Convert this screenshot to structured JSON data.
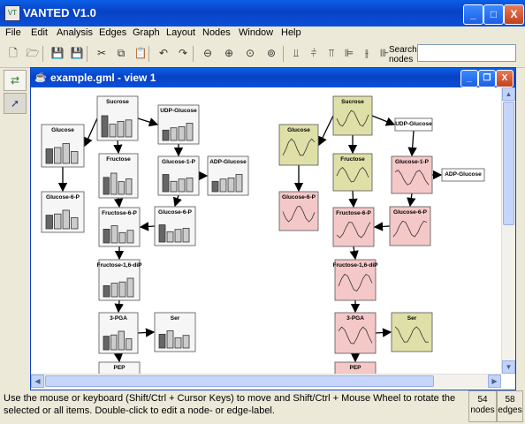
{
  "app": {
    "title": "VANTED V1.0",
    "icon_text": "VT"
  },
  "window_buttons": {
    "minimize": "_",
    "maximize": "□",
    "close": "X"
  },
  "menu": [
    {
      "label": "File",
      "underline_first": true
    },
    {
      "label": "Edit",
      "underline_first": true
    },
    {
      "label": "Analysis"
    },
    {
      "label": "Edges"
    },
    {
      "label": "Graph"
    },
    {
      "label": "Layout"
    },
    {
      "label": "Nodes"
    },
    {
      "label": "Window",
      "underline_first": true
    },
    {
      "label": "Help",
      "underline_first": true
    }
  ],
  "toolbar": {
    "icons": [
      "new-file-icon",
      "open-folder-icon",
      "save-icon",
      "save-as-icon",
      "cut-icon",
      "copy-icon",
      "paste-icon",
      "undo-icon",
      "redo-icon",
      "zoom-out-icon",
      "zoom-in-icon",
      "zoom-fit-icon",
      "zoom-reset-icon",
      "align-bottom-icon",
      "align-middle-icon",
      "align-top-icon",
      "align-left-icon",
      "align-center-icon",
      "align-right-icon",
      "distribute-h-icon",
      "distribute-v-icon"
    ],
    "search_label_1": "Search",
    "search_label_2": "nodes",
    "search_value": ""
  },
  "inner_window": {
    "title": "example.gml - view 1"
  },
  "graph": {
    "left_nodes": [
      {
        "label": "Sucrose"
      },
      {
        "label": "UDP-Glucose"
      },
      {
        "label": "Glucose"
      },
      {
        "label": "Fructose"
      },
      {
        "label": "Glucose-1-P"
      },
      {
        "label": "ADP-Glucose"
      },
      {
        "label": "Glucose-6-P"
      },
      {
        "label": "Fructose-6-P"
      },
      {
        "label": "Glucose-6-P"
      },
      {
        "label": "Fructose-1,6-diP"
      },
      {
        "label": "3-PGA"
      },
      {
        "label": "Ser"
      },
      {
        "label": "PEP"
      }
    ],
    "right_nodes": [
      {
        "label": "Sucrose"
      },
      {
        "label": "UDP-Glucose"
      },
      {
        "label": "Glucose"
      },
      {
        "label": "Fructose"
      },
      {
        "label": "Glucose-1-P"
      },
      {
        "label": "ADP-Glucose"
      },
      {
        "label": "Glucose-6-P"
      },
      {
        "label": "Fructose-6-P"
      },
      {
        "label": "Glucose-6-P"
      },
      {
        "label": "Fructose-1,6-diP"
      },
      {
        "label": "3-PGA"
      },
      {
        "label": "Ser"
      },
      {
        "label": "PEP"
      }
    ],
    "colors": {
      "yellow": "#dfe0a8",
      "pink": "#f5c8c8",
      "node_border": "#555555",
      "bar_dark": "#666666",
      "bar_light": "#cccccc"
    }
  },
  "status": {
    "message": "Use the mouse or keyboard (Shift/Ctrl + Cursor Keys) to move and Shift/Ctrl + Mouse Wheel to rotate the selected or all items. Double-click to edit a node- or edge-label.",
    "nodes_count": "54",
    "nodes_label": "nodes",
    "edges_count": "58",
    "edges_label": "edges"
  }
}
